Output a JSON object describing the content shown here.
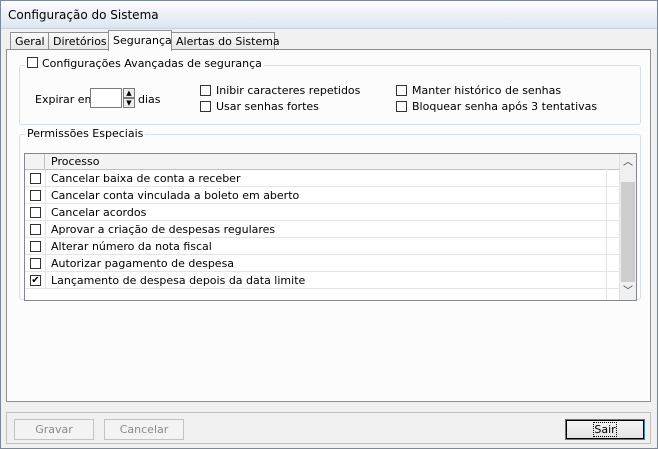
{
  "window": {
    "title": "Configuração do Sistema"
  },
  "tabs": [
    {
      "label": "Geral"
    },
    {
      "label": "Diretórios"
    },
    {
      "label": "Segurança"
    },
    {
      "label": "Alertas do Sistema"
    }
  ],
  "active_tab": "Segurança",
  "advanced": {
    "legend": "Configurações Avançadas de segurança",
    "enabled": false,
    "expire_label": "Expirar em",
    "expire_value": "",
    "expire_unit": "dias",
    "options": [
      {
        "label": "Inibir caracteres repetidos",
        "checked": false
      },
      {
        "label": "Usar senhas fortes",
        "checked": false
      },
      {
        "label": "Manter histórico de senhas",
        "checked": false
      },
      {
        "label": "Bloquear senha após 3 tentativas",
        "checked": false
      }
    ]
  },
  "permissions": {
    "legend": "Permissões Especiais",
    "column_header": "Processo",
    "rows": [
      {
        "label": "Cancelar baixa de conta a receber",
        "checked": false
      },
      {
        "label": "Cancelar conta vinculada a boleto em aberto",
        "checked": false
      },
      {
        "label": "Cancelar acordos",
        "checked": false
      },
      {
        "label": "Aprovar a criação de despesas regulares",
        "checked": false
      },
      {
        "label": "Alterar número da nota fiscal",
        "checked": false
      },
      {
        "label": "Autorizar pagamento de despesa",
        "checked": false
      },
      {
        "label": "Lançamento de despesa depois da data limite",
        "checked": true
      }
    ]
  },
  "buttons": {
    "save": "Gravar",
    "cancel": "Cancelar",
    "exit": "Sair"
  },
  "checkmark": "✔"
}
